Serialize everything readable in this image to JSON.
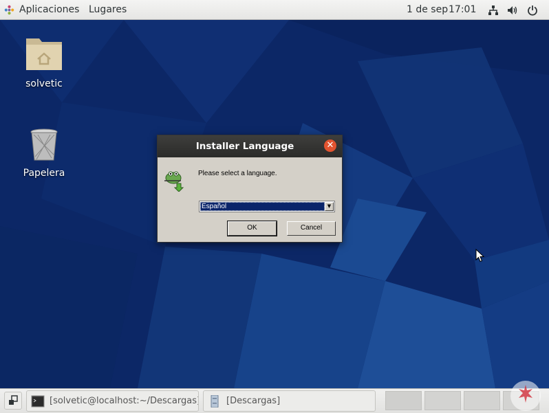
{
  "topbar": {
    "apps_menu": "Aplicaciones",
    "places_menu": "Lugares",
    "date": "1 de sep",
    "time": "17:01",
    "icons": [
      "network-icon",
      "volume-icon",
      "power-icon"
    ]
  },
  "desktop": {
    "icons": [
      {
        "label": "solvetic",
        "icon": "home-folder-icon"
      },
      {
        "label": "Papelera",
        "icon": "trash-icon"
      }
    ],
    "wallpaper_color": "#0d2a66"
  },
  "dialog": {
    "title": "Installer Language",
    "prompt": "Please select a language.",
    "selected_language": "Español",
    "ok_label": "OK",
    "cancel_label": "Cancel",
    "close_color": "#e2532f"
  },
  "taskbar": {
    "windows": [
      {
        "label": "[solvetic@localhost:~/Descargas]",
        "icon": "terminal-icon"
      },
      {
        "label": "[Descargas]",
        "icon": "file-cabinet-icon"
      }
    ],
    "workspaces": 4
  }
}
